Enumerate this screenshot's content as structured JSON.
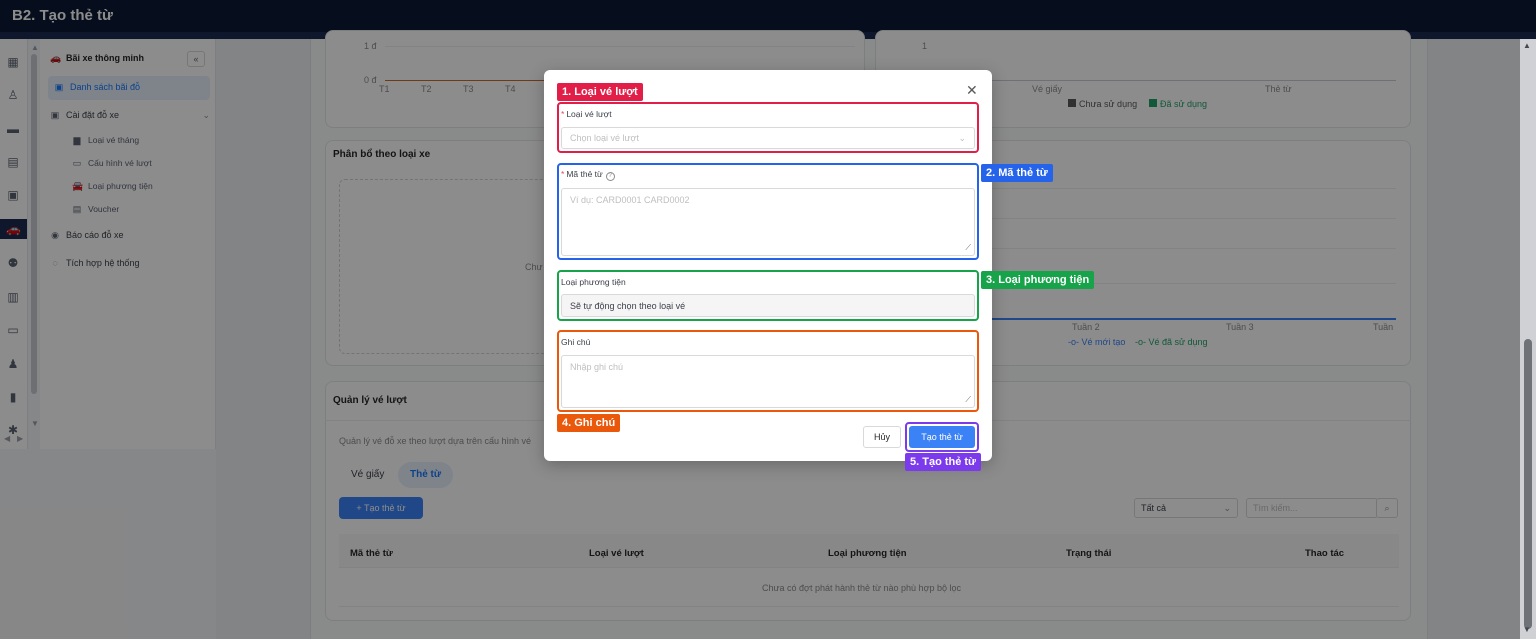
{
  "header": {
    "title": "B2. Tạo thẻ từ"
  },
  "rail": {
    "icons": [
      "building-icon",
      "user-badge-icon",
      "chat-icon",
      "document-icon",
      "briefcase-icon",
      "car-icon",
      "users-icon",
      "office-icon",
      "store-icon",
      "person-icon",
      "chart-icon",
      "gear-icon"
    ]
  },
  "sidebar": {
    "section_title": "Bãi xe thông minh",
    "items": [
      {
        "label": "Danh sách bãi đỗ"
      },
      {
        "label": "Cài đặt đỗ xe"
      },
      {
        "label": "Loại vé tháng"
      },
      {
        "label": "Cấu hình vé lượt"
      },
      {
        "label": "Loại phương tiện"
      },
      {
        "label": "Voucher"
      },
      {
        "label": "Báo cáo đỗ xe"
      },
      {
        "label": "Tích hợp hệ thống"
      }
    ]
  },
  "background": {
    "left_chart": {
      "y_ticks": [
        "1 đ",
        "0 đ"
      ],
      "x_ticks": [
        "T1",
        "T2",
        "T3",
        "T4"
      ]
    },
    "right_chart": {
      "y_ticks": [
        "1"
      ],
      "x_ticks": [
        "Vé giấy",
        "Thẻ từ"
      ],
      "legend": [
        "Chưa sử dụng",
        "Đã sử dụng"
      ]
    },
    "distribution_card": {
      "title": "Phân bổ theo loại xe",
      "empty_text_partial": "Chư"
    },
    "week_chart": {
      "x_ticks": [
        "Tuần 2",
        "Tuần 3",
        "Tuần"
      ],
      "legend": [
        "Vé mới tạo",
        "Vé đã sử dụng"
      ]
    },
    "management": {
      "title": "Quản lý vé lượt",
      "description_partial": "Quản lý vé đỗ xe theo lượt dựa trên cấu hình vé",
      "tabs": [
        "Vé giấy",
        "Thẻ từ"
      ],
      "create_button": "Tạo thẻ từ",
      "filter_value": "Tất cả",
      "search_placeholder": "Tìm kiếm...",
      "columns": [
        "Mã thẻ từ",
        "Loại vé lượt",
        "Loại phương tiện",
        "Trạng thái",
        "Thao tác"
      ],
      "empty_text": "Chưa có đợt phát hành thẻ từ nào phù hợp bộ lọc"
    }
  },
  "modal": {
    "annotations": {
      "a1": "1. Loại vé lượt",
      "a2": "2. Mã thẻ từ",
      "a3": "3. Loại phương tiện",
      "a4": "4. Ghi chú",
      "a5": "5. Tạo thẻ từ"
    },
    "ticket_type": {
      "label": "Loại vé lượt",
      "placeholder": "Chọn loại vé lượt"
    },
    "card_code": {
      "label": "Mã thẻ từ",
      "placeholder": "Ví dụ: CARD0001 CARD0002"
    },
    "vehicle_type": {
      "label": "Loại phương tiện",
      "value": "Sẽ tự động chọn theo loại vé"
    },
    "note": {
      "label": "Ghi chú",
      "placeholder": "Nhập ghi chú"
    },
    "cancel_label": "Hủy",
    "submit_label": "Tạo thẻ từ"
  },
  "colors": {
    "annotation_1": "#e11d48",
    "annotation_2": "#2563eb",
    "annotation_3": "#16a34a",
    "annotation_4": "#ea580c",
    "annotation_5": "#7c3aed",
    "primary": "#3b82f6"
  }
}
